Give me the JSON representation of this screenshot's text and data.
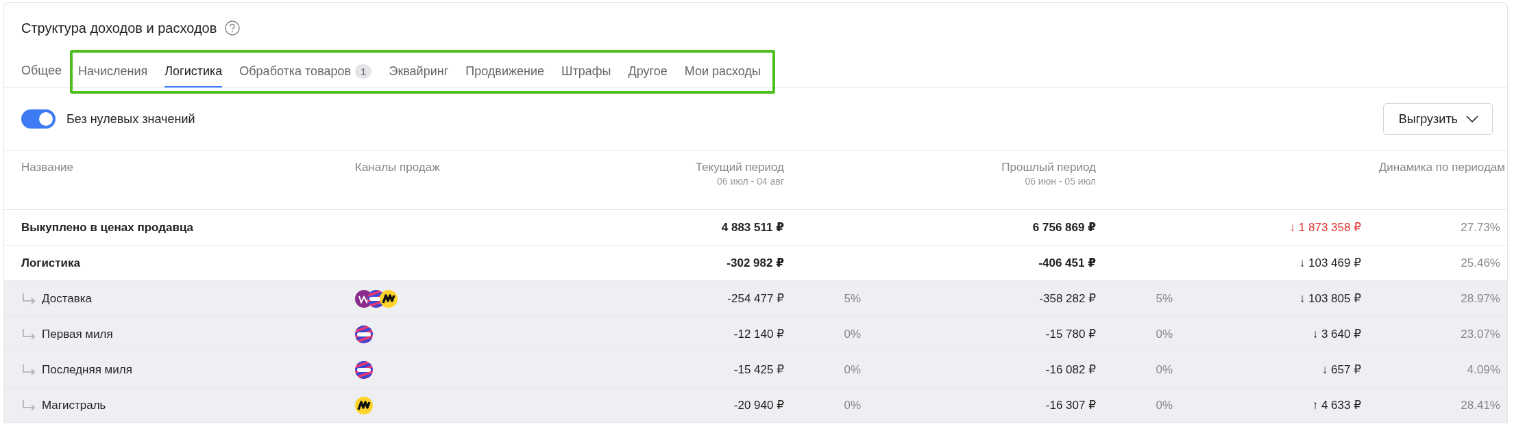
{
  "title": "Структура доходов и расходов",
  "tabs": [
    {
      "label": "Общее",
      "selected": false
    }
  ],
  "highlighted_tabs": [
    {
      "label": "Начисления",
      "selected": false
    },
    {
      "label": "Логистика",
      "selected": true
    },
    {
      "label": "Обработка товаров",
      "badge": "1",
      "selected": false
    },
    {
      "label": "Эквайринг",
      "selected": false
    },
    {
      "label": "Продвижение",
      "selected": false
    },
    {
      "label": "Штрафы",
      "selected": false
    },
    {
      "label": "Другое",
      "selected": false
    },
    {
      "label": "Мои расходы",
      "selected": false
    }
  ],
  "toggle": {
    "label": "Без нулевых значений",
    "on": true
  },
  "export_button": {
    "label": "Выгрузить"
  },
  "columns": [
    {
      "label": "Название"
    },
    {
      "label": "Каналы продаж"
    },
    {
      "label": "Текущий период",
      "period": "06 июл - 04 авг"
    },
    {
      "label": "Прошлый период",
      "period": "06 июн - 05 июл"
    },
    {
      "label": "Динамика по периодам"
    }
  ],
  "rows": [
    {
      "kind": "total",
      "name": "Выкуплено в ценах продавца",
      "current": "4 883 511 ₽",
      "past": "6 756 869 ₽",
      "alert": true,
      "change": "↓ 1 873 358 ₽",
      "change_pct": "27.73%"
    },
    {
      "kind": "total",
      "name": "Логистика",
      "current": "-302 982 ₽",
      "past": "-406 451 ₽",
      "alert": false,
      "change": "↓ 103 469 ₽",
      "change_pct": "25.46%"
    },
    {
      "kind": "sub",
      "name": "Доставка",
      "channels": [
        {
          "kind": "wb"
        },
        {
          "kind": "ozon"
        },
        {
          "kind": "ym"
        }
      ],
      "current": "-254 477 ₽",
      "current_share": "5%",
      "past": "-358 282 ₽",
      "past_share": "5%",
      "alert": false,
      "change": "↓ 103 805 ₽",
      "change_pct": "28.97%"
    },
    {
      "kind": "sub",
      "name": "Первая миля",
      "channels": [
        {
          "kind": "ozon"
        }
      ],
      "current": "-12 140 ₽",
      "current_share": "0%",
      "past": "-15 780 ₽",
      "past_share": "0%",
      "alert": false,
      "change": "↓ 3 640 ₽",
      "change_pct": "23.07%"
    },
    {
      "kind": "sub",
      "name": "Последняя миля",
      "channels": [
        {
          "kind": "ozon"
        }
      ],
      "current": "-15 425 ₽",
      "current_share": "0%",
      "past": "-16 082 ₽",
      "past_share": "0%",
      "alert": false,
      "change": "↓ 657 ₽",
      "change_pct": "4.09%"
    },
    {
      "kind": "sub",
      "name": "Магистраль",
      "channels": [
        {
          "kind": "ym"
        }
      ],
      "current": "-20 940 ₽",
      "current_share": "0%",
      "past": "-16 307 ₽",
      "past_share": "0%",
      "alert": false,
      "change": "↑ 4 633 ₽",
      "change_pct": "28.41%"
    }
  ]
}
